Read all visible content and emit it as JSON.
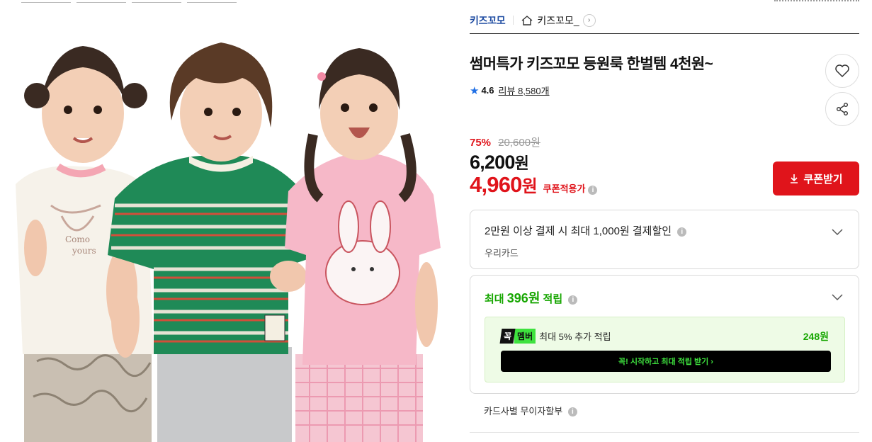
{
  "store": {
    "brand": "키즈꼬모",
    "home_name": "키즈꼬모_"
  },
  "product": {
    "title": "썸머특가 키즈꼬모 등원룩 한벌템 4천원~",
    "rating": "4.6",
    "review_label": "리뷰 8,580개"
  },
  "price": {
    "discount_rate": "75%",
    "original": "20,600원",
    "sale_value": "6,200",
    "sale_unit": "원",
    "coupon_value": "4,960",
    "coupon_unit": "원",
    "coupon_label": "쿠폰적용가"
  },
  "coupon_button": {
    "label": "쿠폰받기"
  },
  "card_benefit": {
    "title": "2만원 이상 결제 시 최대 1,000원 결제할인",
    "card": "우리카드"
  },
  "points": {
    "prefix": "최대 ",
    "amount": "396원",
    "suffix": " 적립",
    "member_badge_1": "꼭",
    "member_badge_2": "멤버",
    "member_text": "최대 5% 추가 적립",
    "member_amount": "248원",
    "member_cta": "꼭! 시작하고 최대 적립 받기 ›"
  },
  "installment": {
    "label": "카드사별 무이자할부"
  },
  "colors": {
    "accent_red": "#e0141b",
    "brand_blue": "#1d4ba1",
    "point_green": "#16a600"
  }
}
